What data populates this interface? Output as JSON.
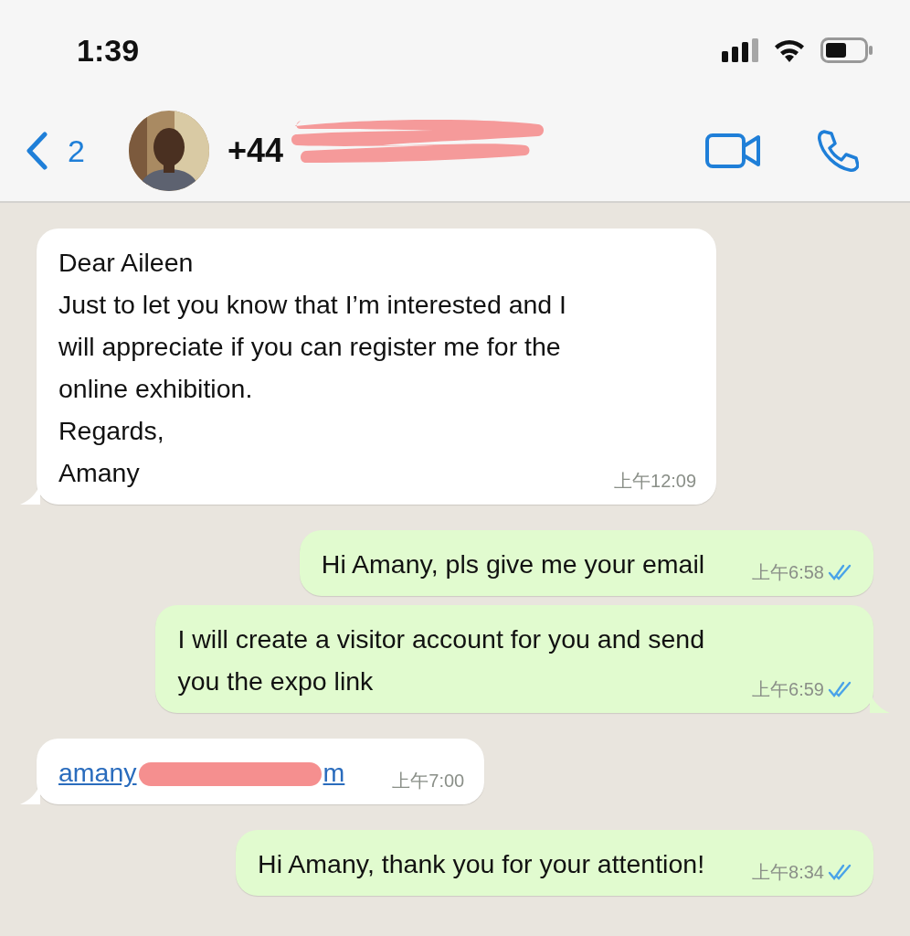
{
  "status_bar": {
    "time": "1:39"
  },
  "header": {
    "back_count": "2",
    "title": "+44",
    "title_redacted": true
  },
  "messages": [
    {
      "kind": "in",
      "tail": true,
      "lines": [
        "Dear Aileen",
        "Just to let you know that I’m interested and I",
        "will appreciate if you can register me for the",
        "online exhibition.",
        "Regards,",
        "Amany"
      ],
      "time": "上午12:09"
    },
    {
      "kind": "out",
      "tail": false,
      "read": true,
      "lines": [
        "Hi Amany, pls give me your email"
      ],
      "time": "上午6:58"
    },
    {
      "kind": "out",
      "tail": true,
      "read": true,
      "lines": [
        "I will create a visitor account for you and send",
        "you the expo link"
      ],
      "time": "上午6:59"
    },
    {
      "kind": "in",
      "tail": true,
      "link": {
        "before": "amany",
        "after": "m",
        "redacted": true
      },
      "time": "上午7:00"
    },
    {
      "kind": "out",
      "tail": false,
      "read": true,
      "lines": [
        "Hi Amany, thank you for your attention!"
      ],
      "time": "上午8:34"
    }
  ]
}
